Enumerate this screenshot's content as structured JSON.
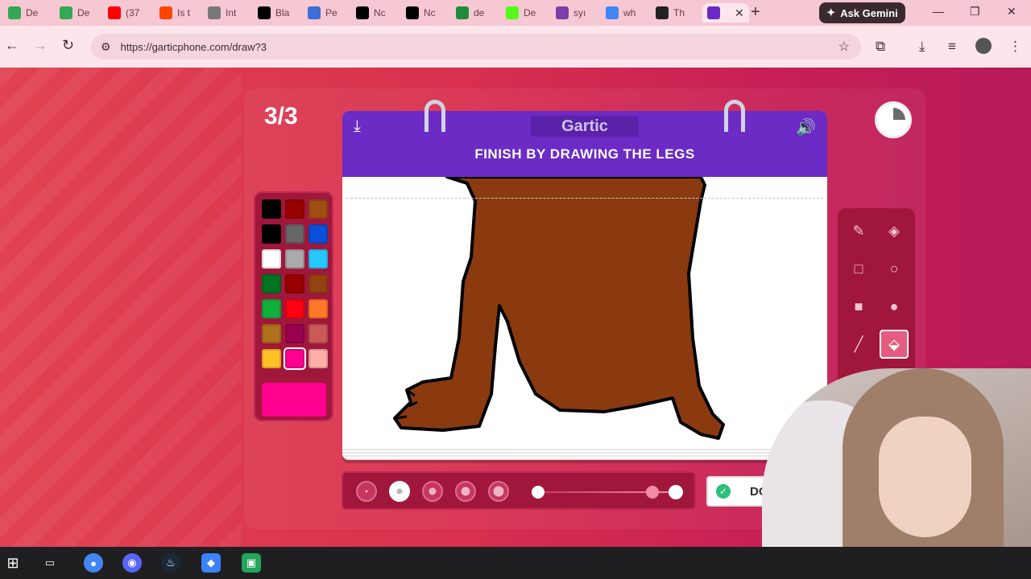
{
  "browser": {
    "tabs": [
      {
        "label": "De",
        "icon": "google-drive-icon",
        "color": "#34a853"
      },
      {
        "label": "De",
        "icon": "google-drive-icon",
        "color": "#34a853"
      },
      {
        "label": "(37",
        "icon": "youtube-icon",
        "color": "#ff0000"
      },
      {
        "label": "Is t",
        "icon": "reddit-icon",
        "color": "#ff4500"
      },
      {
        "label": "Int",
        "icon": "globe-icon",
        "color": "#777777"
      },
      {
        "label": "Bla",
        "icon": "wix-icon",
        "color": "#000000"
      },
      {
        "label": "Pe",
        "icon": "bar-icon",
        "color": "#3b6fd6"
      },
      {
        "label": "Nc",
        "icon": "x-icon",
        "color": "#000000"
      },
      {
        "label": "Nc",
        "icon": "x-icon",
        "color": "#000000"
      },
      {
        "label": "de",
        "icon": "sheet-icon",
        "color": "#1f8b3b"
      },
      {
        "label": "De",
        "icon": "k-icon",
        "color": "#53fc18"
      },
      {
        "label": "syı",
        "icon": "peace-icon",
        "color": "#7a3ea8"
      },
      {
        "label": "wh",
        "icon": "google-icon",
        "color": "#4285f4"
      },
      {
        "label": "Th",
        "icon": "terminal-icon",
        "color": "#222222"
      },
      {
        "label": "",
        "icon": "gartic-icon",
        "color": "#6b2bc4",
        "active": true
      }
    ],
    "ask_gemini": "Ask Gemini",
    "url": "https://garticphone.com/draw?3"
  },
  "game": {
    "round": "3/3",
    "logo": "Gartic",
    "instruction": "FINISH BY DRAWING THE LEGS",
    "done_label": "DONE!",
    "timer_elapsed_fraction": 0.25,
    "palette": {
      "colors": [
        "#000000",
        "#990000",
        "#a04e14",
        "#000000",
        "#666666",
        "#0a4fd8",
        "#ffffff",
        "#aaaaaa",
        "#26c9ff",
        "#017420",
        "#990000",
        "#964112",
        "#11b03c",
        "#ff0013",
        "#ff7829",
        "#b0701c",
        "#99004e",
        "#cb5a57",
        "#ffc126",
        "#ff008f",
        "#feafa8"
      ],
      "selected_index": 19,
      "current_color": "#ff008f"
    },
    "tools": [
      {
        "name": "pen-icon"
      },
      {
        "name": "eraser-icon"
      },
      {
        "name": "rectangle-outline-icon"
      },
      {
        "name": "ellipse-outline-icon"
      },
      {
        "name": "rectangle-filled-icon"
      },
      {
        "name": "ellipse-filled-icon"
      },
      {
        "name": "line-icon"
      },
      {
        "name": "bucket-fill-icon",
        "selected": true
      }
    ],
    "stroke_sizes_selected_index": 1,
    "opacity_fraction": 0.85
  }
}
